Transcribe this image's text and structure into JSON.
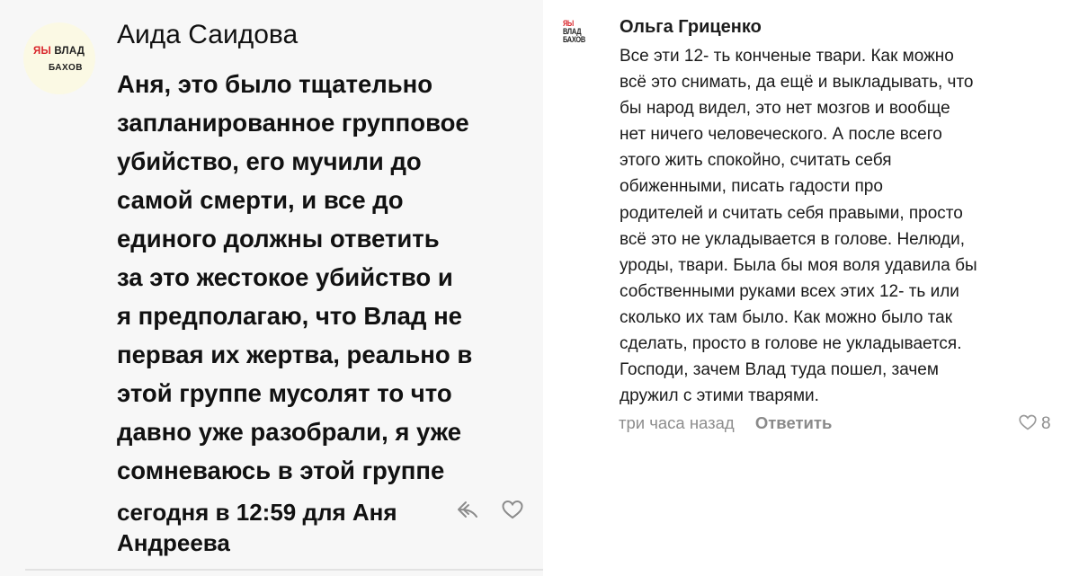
{
  "left_comment": {
    "avatar": {
      "logo_line1_red": "ЯЫ",
      "logo_line1": "ВЛАД",
      "logo_line2": "БАХОВ"
    },
    "author": "Аида Саидова",
    "text_lines": [
      "Аня, это было тщательно",
      "запланированное групповое",
      "убийство, его мучили до",
      "самой смерти, и все до",
      "единого должны ответить",
      "за это жестокое убийство и",
      "я предполагаю, что Влад не",
      "первая их жертва, реально в",
      "этой группе мусолят то что",
      "давно уже разобрали, я уже",
      "сомневаюсь в этой группе"
    ],
    "meta_lines": [
      "сегодня в 12:59 для Аня",
      "Андреева"
    ],
    "icons": {
      "reply": "reply-icon",
      "like": "heart-icon"
    }
  },
  "right_comment": {
    "avatar": {
      "line1_red": "ЯЫ",
      "line2": "ВЛАД",
      "line3": "БАХОВ"
    },
    "author": "Ольга Гриценко",
    "text_lines": [
      "Все эти 12- ть конченые твари. Как можно",
      "всё это снимать, да ещё и выкладывать, что",
      "бы народ видел, это нет мозгов и вообще",
      "нет ничего человеческого. А после всего",
      "этого жить спокойно, считать себя",
      "обиженными, писать гадости про",
      "родителей и считать себя правыми, просто",
      "всё это не укладывается в голове. Нелюди,",
      "уроды, твари. Была бы моя воля удавила бы",
      "собственными руками всех этих 12- ть или",
      "сколько их там было. Как можно было так",
      "сделать, просто в голове не укладывается.",
      "Господи, зачем Влад туда пошел, зачем",
      "дружил с этими тварями."
    ],
    "time": "три часа назад",
    "reply_label": "Ответить",
    "likes": "8",
    "icons": {
      "like": "heart-icon"
    }
  },
  "colors": {
    "red_accent": "#d9262b",
    "meta_gray": "#8d8d8d",
    "left_bg": "#f7f7f7"
  }
}
